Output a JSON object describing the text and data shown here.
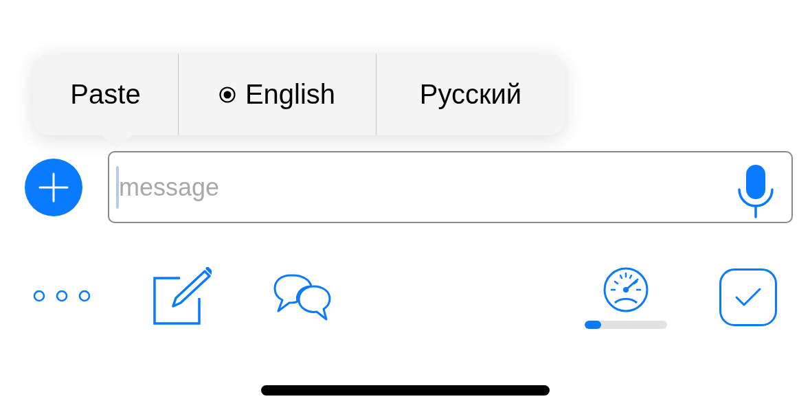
{
  "context_menu": {
    "items": [
      {
        "label": "Paste",
        "selected": false
      },
      {
        "label": "English",
        "selected": true
      },
      {
        "label": "Русский",
        "selected": false
      }
    ]
  },
  "message_field": {
    "placeholder": "message"
  },
  "toolbar": {
    "progress": {
      "level": 0.2
    },
    "done_checkbox": {
      "checked": true
    }
  }
}
